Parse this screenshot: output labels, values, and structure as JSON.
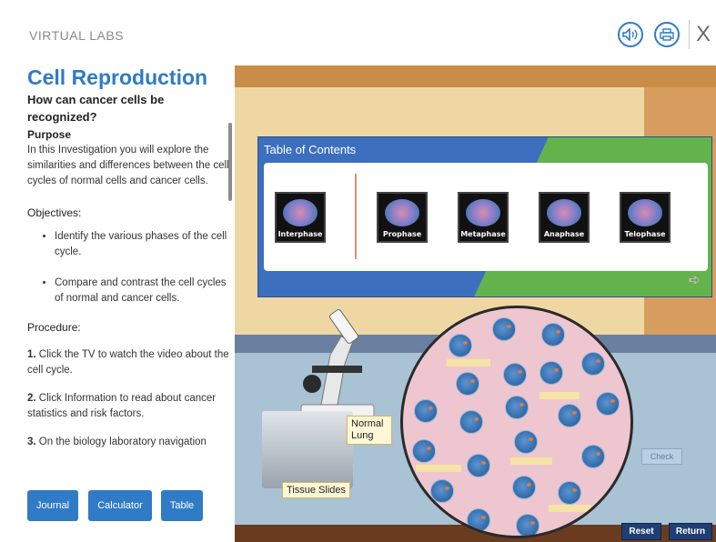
{
  "header": {
    "brand": "VIRTUAL LABS",
    "icons": [
      "audio-icon",
      "print-icon",
      "close-icon"
    ],
    "close_label": "X"
  },
  "left_panel": {
    "title": "Cell Reproduction",
    "question": "How can cancer cells be recognized?",
    "purpose_heading": "Purpose",
    "purpose_text": "In this Investigation you will explore the similarities and differences between the cell cycles of normal cells and cancer cells.",
    "objectives_heading": "Objectives:",
    "objectives": [
      "Identify the various phases of the cell cycle.",
      "Compare and contrast the cell cycles of normal and cancer cells."
    ],
    "procedure_heading": "Procedure:",
    "steps": [
      {
        "num": "1.",
        "text": "Click the TV to watch the video about the cell cycle."
      },
      {
        "num": "2.",
        "text": "Click Information to read about cancer statistics and risk factors."
      },
      {
        "num": "3.",
        "text": "On the biology laboratory navigation"
      }
    ],
    "buttons": {
      "journal": "Journal",
      "calculator": "Calculator",
      "table": "Table"
    }
  },
  "scene": {
    "toc_title": "Table of Contents",
    "phases": [
      "Interphase",
      "Prophase",
      "Metaphase",
      "Anaphase",
      "Telophase"
    ],
    "normal_lung_label": "Normal Lung",
    "tissue_slides_label": "Tissue Slides",
    "check_label": "Check",
    "reset_label": "Reset",
    "return_label": "Return"
  },
  "colors": {
    "accent": "#2f7bc6",
    "toc_blue": "#3d6fbf",
    "toc_green": "#63b34d",
    "sample_pink": "#eec6cf",
    "dark_button": "#1f3f74"
  }
}
